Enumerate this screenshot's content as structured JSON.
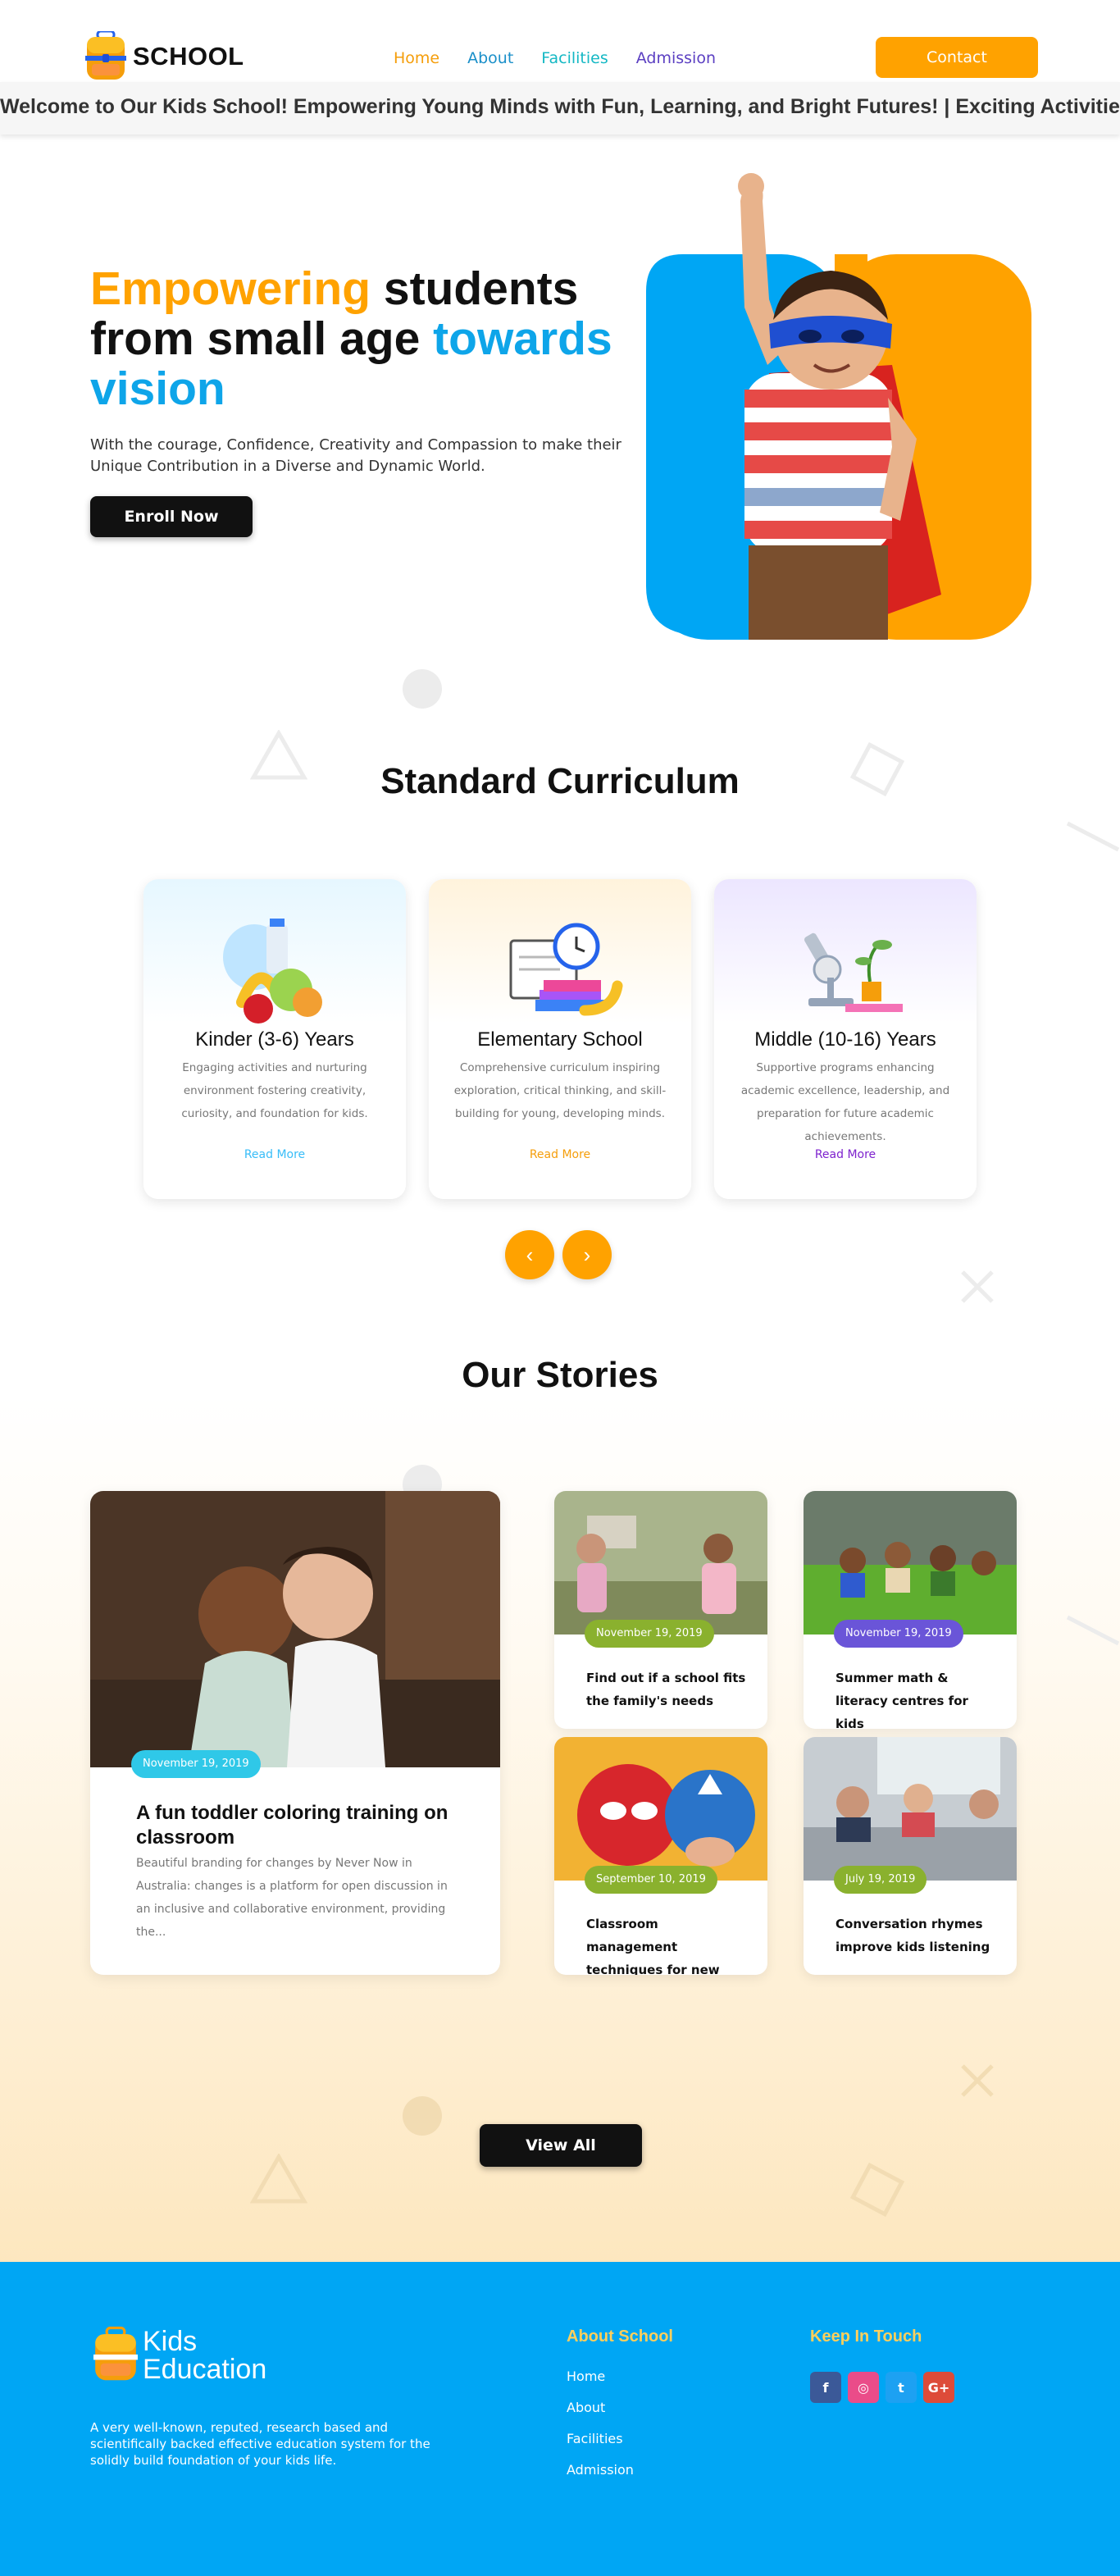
{
  "nav": {
    "logo_text": "SCHOOL",
    "links": [
      {
        "label": "Home"
      },
      {
        "label": "About"
      },
      {
        "label": "Facilities"
      },
      {
        "label": "Admission"
      }
    ],
    "contact_label": "Contact"
  },
  "marquee": {
    "text": "Welcome to Our Kids School! Empowering Young Minds with Fun, Learning, and Bright Futures! | Exciting Activities"
  },
  "hero": {
    "title_highlight1": "Empowering",
    "title_mid": " students from small age ",
    "title_highlight2": "towards vision",
    "subtitle": "With the courage, Confidence, Creativity and Compassion to make their Unique Contribution in a Diverse and Dynamic World.",
    "cta": "Enroll Now"
  },
  "curriculum": {
    "title": "Standard Curriculum",
    "cards": [
      {
        "title": "Kinder (3-6) Years",
        "text": "Engaging activities and nurturing environment fostering creativity, curiosity, and foundation for kids.",
        "link": "Read More",
        "accent": "#38bdf8"
      },
      {
        "title": "Elementary School",
        "text": "Comprehensive curriculum inspiring exploration, critical thinking, and skill-building for young, developing minds.",
        "link": "Read More",
        "accent": "#f59e0b"
      },
      {
        "title": "Middle (10-16) Years",
        "text": "Supportive programs enhancing academic excellence, leadership, and preparation for future academic achievements.",
        "link": "Read More",
        "accent": "#7e22ce"
      }
    ],
    "prev_icon": "‹",
    "next_icon": "›"
  },
  "stories": {
    "title": "Our Stories",
    "featured": {
      "date": "November 19, 2019",
      "title": "A fun toddler coloring training on classroom",
      "excerpt": "Beautiful branding for changes by Never Now in Australia: changes is a platform for open discussion in an inclusive and collaborative environment, providing the..."
    },
    "items": [
      {
        "date": "November 19, 2019",
        "title": "Find out if a school fits the family's needs",
        "pill": "#8ab12e"
      },
      {
        "date": "November 19, 2019",
        "title": "Summer math & literacy centres for kids",
        "pill": "#6a55d8"
      },
      {
        "date": "September 10, 2019",
        "title": "Classroom management techniques for new tutors",
        "pill": "#8ab12e"
      },
      {
        "date": "July 19, 2019",
        "title": "Conversation rhymes improve kids listening",
        "pill": "#8ab12e"
      }
    ],
    "view_all": "View All"
  },
  "footer": {
    "logo_line1": "Kids",
    "logo_line2": "Education",
    "description": "A very well-known, reputed, research based and scientifically backed effective education system for the solidly build foundation of your kids life.",
    "about_heading": "About School",
    "about_links": [
      "Home",
      "About",
      "Facilities",
      "Admission"
    ],
    "contact_heading": "Keep In Touch",
    "social": [
      {
        "icon": "facebook-icon",
        "glyph": "f",
        "color": "#3b5998"
      },
      {
        "icon": "dribbble-icon",
        "glyph": "◎",
        "color": "#ea4c89"
      },
      {
        "icon": "twitter-icon",
        "glyph": "t",
        "color": "#1da1f2"
      },
      {
        "icon": "google-plus-icon",
        "glyph": "G+",
        "color": "#dd4b39"
      }
    ]
  }
}
